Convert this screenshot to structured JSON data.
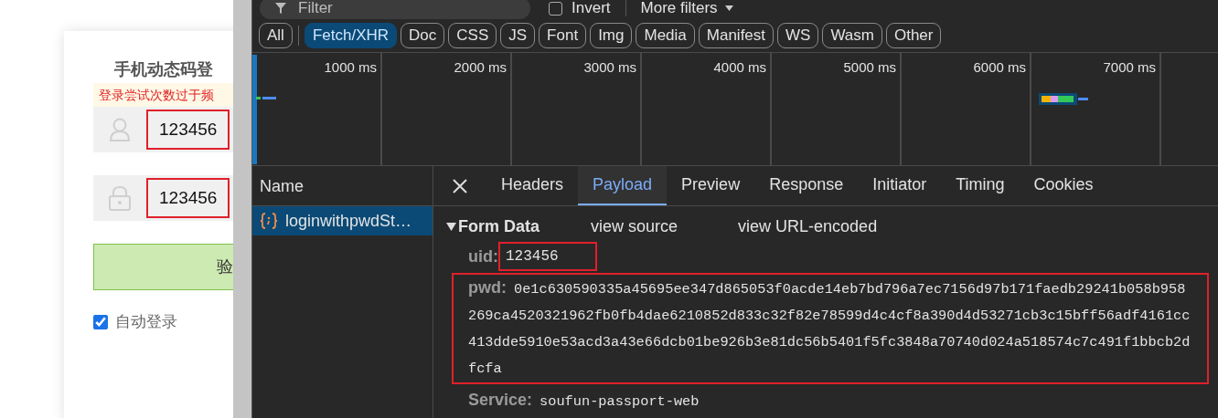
{
  "login_page": {
    "title": "手机动态码登",
    "warning": "登录尝试次数过于频",
    "fields": [
      {
        "kind": "username",
        "value": "123456"
      },
      {
        "kind": "password",
        "value": "123456"
      }
    ],
    "submit_button": "验",
    "auto_login": {
      "label": "自动登录",
      "checked": true
    }
  },
  "devtools": {
    "filter": {
      "placeholder": "Filter"
    },
    "invert": {
      "label": "Invert",
      "checked": false
    },
    "more_filters": "More filters",
    "type_filters": [
      {
        "label": "All",
        "selected": false
      },
      {
        "label": "Fetch/XHR",
        "selected": true
      },
      {
        "label": "Doc",
        "selected": false
      },
      {
        "label": "CSS",
        "selected": false
      },
      {
        "label": "JS",
        "selected": false
      },
      {
        "label": "Font",
        "selected": false
      },
      {
        "label": "Img",
        "selected": false
      },
      {
        "label": "Media",
        "selected": false
      },
      {
        "label": "Manifest",
        "selected": false
      },
      {
        "label": "WS",
        "selected": false
      },
      {
        "label": "Wasm",
        "selected": false
      },
      {
        "label": "Other",
        "selected": false
      }
    ],
    "timeline_ticks": [
      "1000 ms",
      "2000 ms",
      "3000 ms",
      "4000 ms",
      "5000 ms",
      "6000 ms",
      "7000 ms"
    ],
    "requests": {
      "column": "Name",
      "rows": [
        {
          "name": "loginwithpwdSt…",
          "selected": true
        }
      ]
    },
    "detail_tabs": [
      {
        "label": "Headers",
        "selected": false
      },
      {
        "label": "Payload",
        "selected": true
      },
      {
        "label": "Preview",
        "selected": false
      },
      {
        "label": "Response",
        "selected": false
      },
      {
        "label": "Initiator",
        "selected": false
      },
      {
        "label": "Timing",
        "selected": false
      },
      {
        "label": "Cookies",
        "selected": false
      }
    ],
    "form_data": {
      "title": "Form Data",
      "links": [
        "view source",
        "view URL-encoded"
      ],
      "fields": [
        {
          "key": "uid:",
          "value": "123456",
          "highlighted": true
        },
        {
          "key": "pwd:",
          "value": "0e1c630590335a45695ee347d865053f0acde14eb7bd796a7ec7156d97b171faedb29241b058b958269ca4520321962fb0fb4dae6210852d833c32f82e78599d4c4cf8a390d4d53271cb3c15bff56adf4161cc413dde5910e53acd3a43e66dcb01be926b3e81dc56b5401f5fc3848a70740d024a518574c7c491f1bbcb2dfcfa",
          "highlighted": true
        },
        {
          "key": "Service:",
          "value": "soufun-passport-web",
          "highlighted": false
        }
      ]
    }
  }
}
